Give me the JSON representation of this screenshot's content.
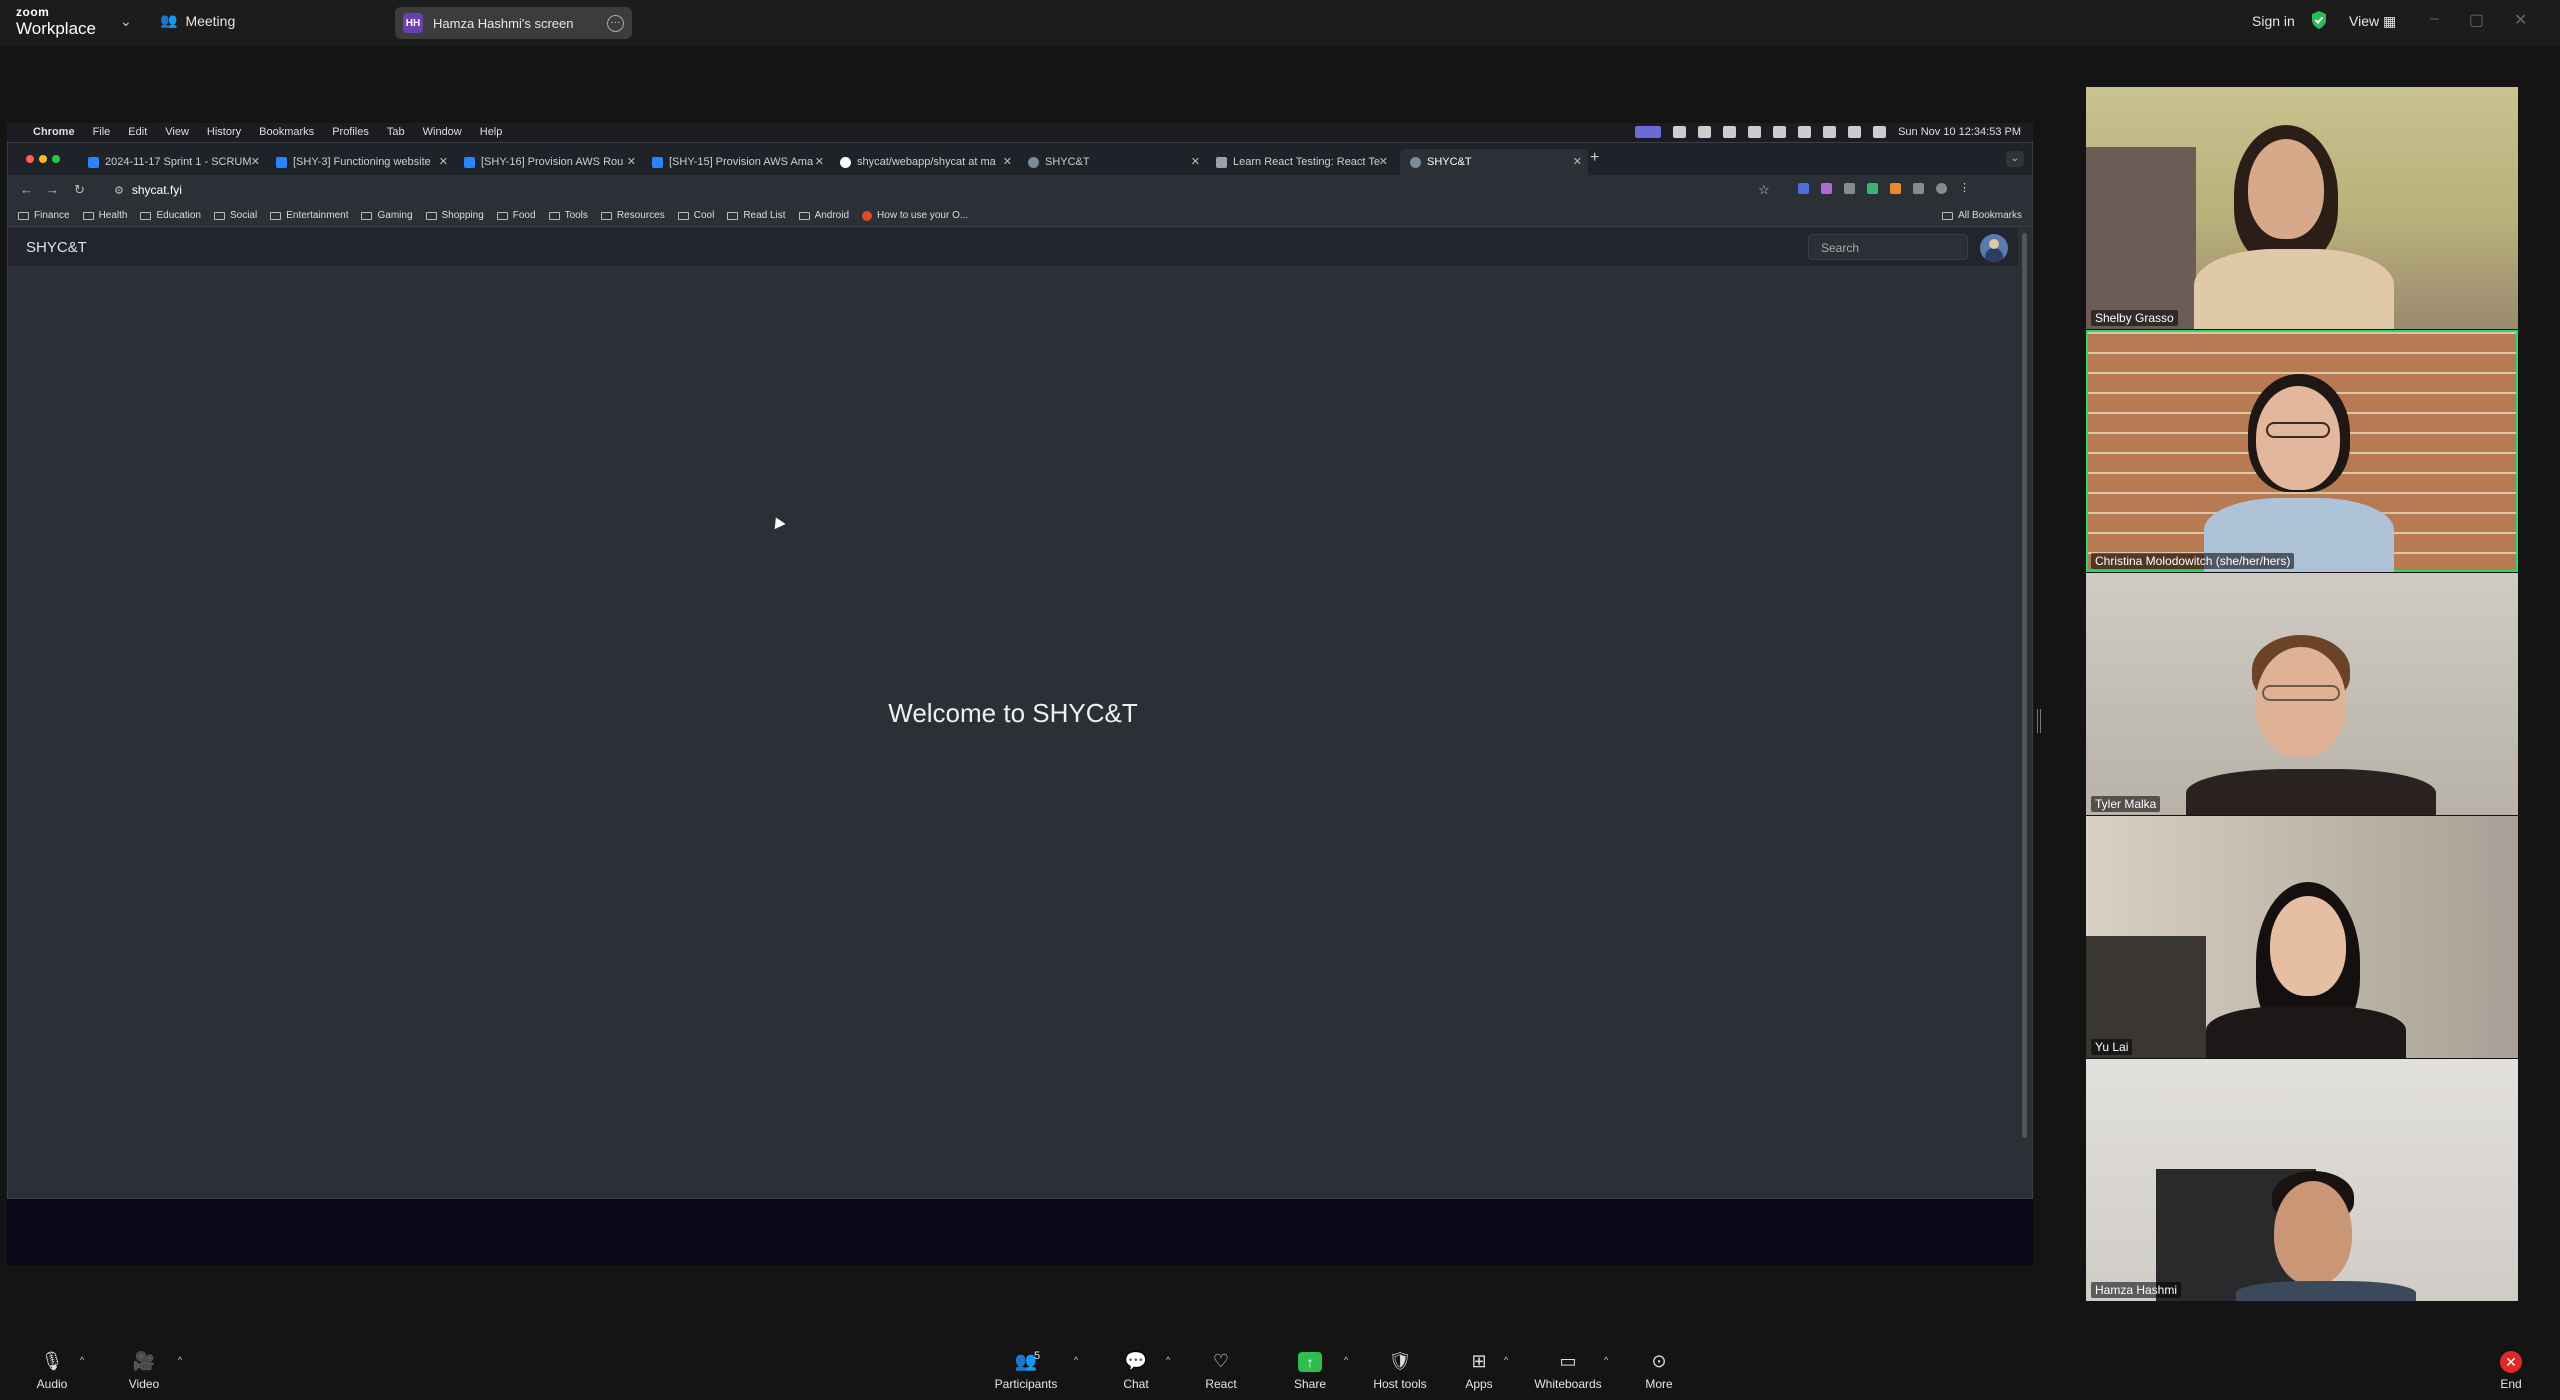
{
  "zoom": {
    "logo_small": "zoom",
    "logo_big": "Workplace",
    "meeting_label": "Meeting",
    "screen_share_initials": "HH",
    "screen_share_label": "Hamza Hashmi's screen",
    "signin_label": "Sign in",
    "view_label": "View",
    "colors": {
      "speaking_outline": "#2bd66b",
      "share_button": "#2fbd4f",
      "end_button": "#e02828"
    }
  },
  "mac_menubar": {
    "items": [
      "Chrome",
      "File",
      "Edit",
      "View",
      "History",
      "Bookmarks",
      "Profiles",
      "Tab",
      "Window",
      "Help"
    ],
    "clock": "Sun Nov 10  12:34:53 PM"
  },
  "chrome": {
    "tabs": [
      {
        "title": "2024-11-17 Sprint 1 - SCRUM",
        "favicon": "jira-icon",
        "color": "#2684ff"
      },
      {
        "title": "[SHY-3] Functioning website",
        "favicon": "jira-icon",
        "color": "#2684ff"
      },
      {
        "title": "[SHY-16] Provision AWS Rou",
        "favicon": "jira-icon",
        "color": "#2684ff"
      },
      {
        "title": "[SHY-15] Provision AWS Ama",
        "favicon": "jira-icon",
        "color": "#2684ff"
      },
      {
        "title": "shycat/webapp/shycat at ma",
        "favicon": "github-icon",
        "color": "#ffffff"
      },
      {
        "title": "SHYC&T",
        "favicon": "globe-icon",
        "color": "#7a8b99"
      },
      {
        "title": "Learn React Testing: React Te",
        "favicon": "page-icon",
        "color": "#9aa0a6"
      },
      {
        "title": "SHYC&T",
        "favicon": "globe-icon",
        "color": "#7a8b99"
      }
    ],
    "url": "shycat.fyi",
    "bookmarks": [
      "Finance",
      "Health",
      "Education",
      "Social",
      "Entertainment",
      "Gaming",
      "Shopping",
      "Food",
      "Tools",
      "Resources",
      "Cool",
      "Read List",
      "Android"
    ],
    "bookmark_link": "How to use your O...",
    "all_bookmarks": "All Bookmarks"
  },
  "site": {
    "brand": "SHYC&T",
    "search_placeholder": "Search",
    "welcome": "Welcome to SHYC&T"
  },
  "participants": [
    {
      "name": "Shelby Grasso",
      "speaking": false
    },
    {
      "name": "Christina Molodowitch (she/her/hers)",
      "speaking": true
    },
    {
      "name": "Tyler Malka",
      "speaking": false
    },
    {
      "name": "Yu Lai",
      "speaking": false
    },
    {
      "name": "Hamza Hashmi",
      "speaking": false
    }
  ],
  "toolbar": {
    "audio": "Audio",
    "video": "Video",
    "participants": "Participants",
    "participants_count": "5",
    "chat": "Chat",
    "react": "React",
    "share": "Share",
    "host_tools": "Host tools",
    "apps": "Apps",
    "whiteboards": "Whiteboards",
    "more": "More",
    "end": "End"
  }
}
